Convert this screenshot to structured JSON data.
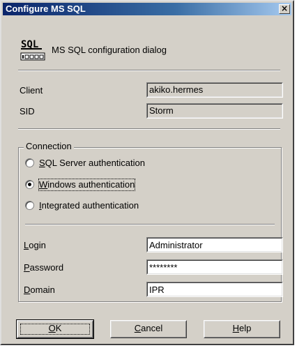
{
  "window": {
    "title": "Configure MS SQL",
    "close_glyph": "×"
  },
  "header": {
    "icon": "sql-database-icon",
    "icon_text": "SQL",
    "description": "MS SQL configuration dialog"
  },
  "info": {
    "client_label": "Client",
    "client_value": "akiko.hermes",
    "sid_label": "SID",
    "sid_value": "Storm"
  },
  "connection": {
    "group_title": "Connection",
    "options": [
      {
        "label": "SQL Server authentication",
        "mnemonic": "S",
        "rest": "QL Server authentication",
        "checked": false
      },
      {
        "label": "Windows authentication",
        "mnemonic": "W",
        "rest": "indows authentication",
        "checked": true
      },
      {
        "label": "Integrated authentication",
        "mnemonic": "I",
        "rest": "ntegrated authentication",
        "checked": false
      }
    ],
    "login_label_mnemonic": "L",
    "login_label_rest": "ogin",
    "login_value": "Administrator",
    "password_label_mnemonic": "P",
    "password_label_rest": "assword",
    "password_value": "********",
    "domain_label_mnemonic": "D",
    "domain_label_rest": "omain",
    "domain_value": "IPR"
  },
  "buttons": {
    "ok_mnemonic": "O",
    "ok_rest": "K",
    "cancel_mnemonic": "C",
    "cancel_rest": "ancel",
    "help_mnemonic": "H",
    "help_rest": "elp"
  },
  "colors": {
    "title_bar_start": "#0a246a",
    "title_bar_end": "#a6caf0",
    "dialog_face": "#d4d0c8"
  }
}
